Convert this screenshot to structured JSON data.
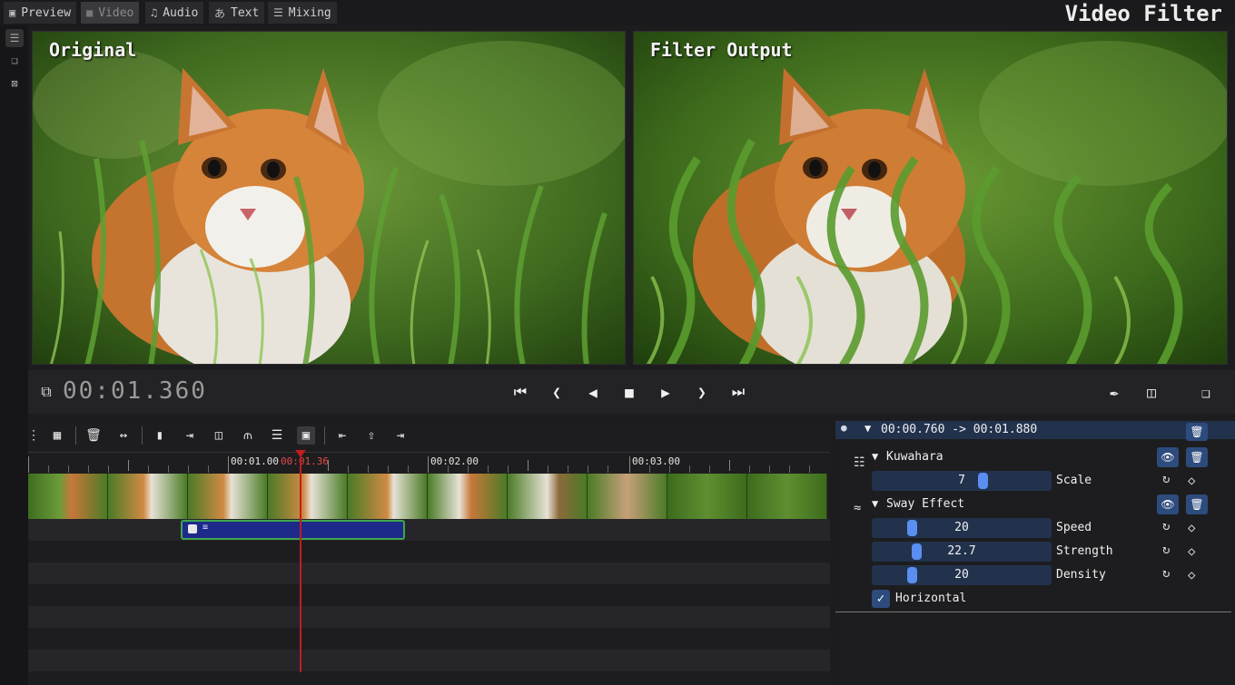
{
  "app_title": "Video Filter",
  "tabs": [
    {
      "label": "Preview",
      "icon": "preview-icon"
    },
    {
      "label": "Video",
      "icon": "video-camera-icon"
    },
    {
      "label": "Audio",
      "icon": "music-note-icon"
    },
    {
      "label": "Text",
      "icon": "translate-icon"
    },
    {
      "label": "Mixing",
      "icon": "sliders-icon"
    }
  ],
  "preview": {
    "left_label": "Original",
    "right_label": "Filter Output"
  },
  "transport": {
    "timecode": "00:01.360"
  },
  "timeline": {
    "ruler_labels": [
      "00:01.00",
      "00:01.36",
      "00:02.00",
      "00:03.00"
    ],
    "playhead_label": "00:01.36"
  },
  "filters": {
    "range_label": "00:00.760 -> 00:01.880",
    "kuwahara": {
      "name": "Kuwahara",
      "scale": {
        "label": "Scale",
        "value": "7"
      }
    },
    "sway": {
      "name": "Sway Effect",
      "speed": {
        "label": "Speed",
        "value": "20"
      },
      "strength": {
        "label": "Strength",
        "value": "22.7"
      },
      "density": {
        "label": "Density",
        "value": "20"
      },
      "horizontal": {
        "label": "Horizontal",
        "checked": true
      }
    }
  },
  "colors": {
    "accent": "#5a8ef0",
    "playhead": "#c21d1d",
    "clip": "#1e2a8a",
    "clip_border": "#3fa64a"
  }
}
